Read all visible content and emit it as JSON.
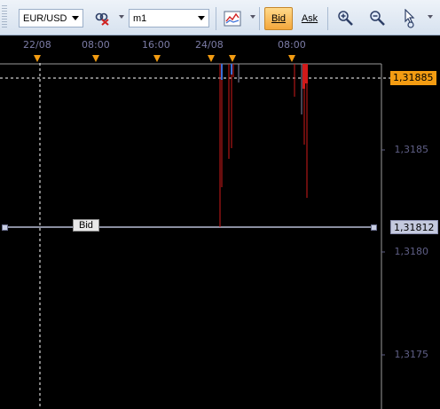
{
  "toolbar": {
    "symbol": "EUR/USD",
    "timeframe": "m1",
    "bid_label": "Bid",
    "ask_label": "Ask"
  },
  "time_axis": {
    "labels": [
      "22/08",
      "08:00",
      "16:00",
      "24/08",
      "08:00"
    ]
  },
  "price_axis": {
    "labels": [
      "1,3185",
      "1,3180",
      "1,3175"
    ],
    "current_price": "1,31885",
    "bid_price": "1,31812"
  },
  "chart": {
    "bid_line_label": "Bid",
    "colors": {
      "background": "#000000",
      "axis_text": "#7c7ca6",
      "crosshair": "#ffffff",
      "bid_line": "#b8bdd6",
      "candle_up": "#3a6fd8",
      "candle_down": "#d11a1a",
      "marker": "#f39c12"
    }
  }
}
